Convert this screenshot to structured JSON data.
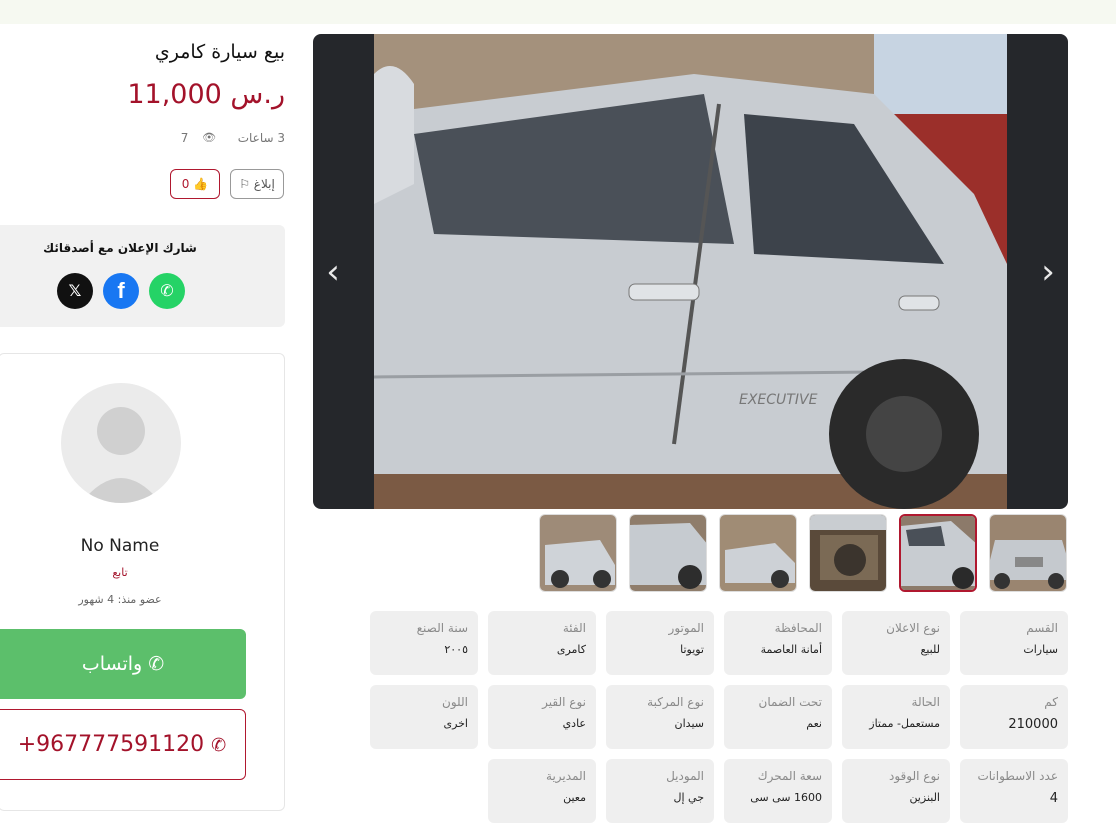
{
  "listing": {
    "title": "بيع سيارة كامري",
    "price": "11,000 ر.س",
    "time_ago": "3 ساعات",
    "views": "7",
    "report_label": "إبلاغ",
    "likes": "0"
  },
  "share": {
    "heading": "شارك الإعلان مع أصدقائك"
  },
  "seller": {
    "name": "No Name",
    "role": "تابع",
    "member_since": "عضو منذ: 4 شهور",
    "whatsapp_label": "واتساب",
    "phone": "+967777591120"
  },
  "specs": [
    {
      "label": "القسم",
      "value": "سيارات"
    },
    {
      "label": "نوع الاعلان",
      "value": "للبيع"
    },
    {
      "label": "المحافظة",
      "value": "أمانة العاصمة"
    },
    {
      "label": "الموتور",
      "value": "تويوتا"
    },
    {
      "label": "الفئة",
      "value": "كامرى"
    },
    {
      "label": "سنة الصنع",
      "value": "٢٠٠٥"
    },
    {
      "label": "كم",
      "value": "210000"
    },
    {
      "label": "الحالة",
      "value": "مستعمل- ممتاز"
    },
    {
      "label": "تحت الضمان",
      "value": "نعم"
    },
    {
      "label": "نوع المركبة",
      "value": "سيدان"
    },
    {
      "label": "نوع القير",
      "value": "عادي"
    },
    {
      "label": "اللون",
      "value": "اخرى"
    },
    {
      "label": "عدد الاسطوانات",
      "value": "4"
    },
    {
      "label": "نوع الوقود",
      "value": "البنزين"
    },
    {
      "label": "سعة المحرك",
      "value": "1600 سى سى"
    },
    {
      "label": "الموديل",
      "value": "جي إل"
    },
    {
      "label": "المديرية",
      "value": "معين"
    }
  ],
  "gallery": {
    "prev_icon": "chevron-left-icon",
    "next_icon": "chevron-right-icon",
    "main_photo": "silver sedan side view",
    "active_thumb_index": 1
  },
  "colors": {
    "brand_red": "#a3122a",
    "whatsapp_green": "#5cbf6b",
    "facebook_blue": "#1877f2",
    "x_black": "#111111"
  }
}
